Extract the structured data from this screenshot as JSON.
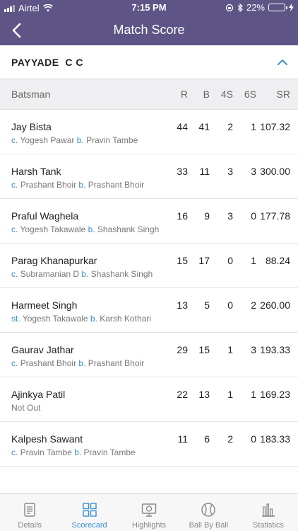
{
  "status": {
    "carrier": "Airtel",
    "time": "7:15 PM",
    "battery": "22%",
    "battery_level": 0.22
  },
  "nav": {
    "title": "Match Score"
  },
  "team": {
    "name": "PAYYADE  C C"
  },
  "header": {
    "batsman": "Batsman",
    "r": "R",
    "b": "B",
    "fours": "4S",
    "sixes": "6S",
    "sr": "SR"
  },
  "batsmen": [
    {
      "name": "Jay Bista",
      "dis1_k": "c.",
      "dis1": "Yogesh Pawar",
      "dis2_k": "b.",
      "dis2": "Pravin Tambe",
      "r": "44",
      "b": "41",
      "fours": "2",
      "sixes": "1",
      "sr": "107.32"
    },
    {
      "name": "Harsh Tank",
      "dis1_k": "c.",
      "dis1": "Prashant Bhoir",
      "dis2_k": "b.",
      "dis2": "Prashant Bhoir",
      "r": "33",
      "b": "11",
      "fours": "3",
      "sixes": "3",
      "sr": "300.00"
    },
    {
      "name": "Praful Waghela",
      "dis1_k": "c.",
      "dis1": "Yogesh Takawale",
      "dis2_k": "b.",
      "dis2": "Shashank Singh",
      "r": "16",
      "b": "9",
      "fours": "3",
      "sixes": "0",
      "sr": "177.78"
    },
    {
      "name": "Parag Khanapurkar",
      "dis1_k": "c.",
      "dis1": "Subramanian D",
      "dis2_k": "b.",
      "dis2": "Shashank Singh",
      "r": "15",
      "b": "17",
      "fours": "0",
      "sixes": "1",
      "sr": "88.24"
    },
    {
      "name": "Harmeet Singh",
      "dis1_k": "st.",
      "dis1": "Yogesh Takawale",
      "dis2_k": "b.",
      "dis2": "Karsh Kothari",
      "r": "13",
      "b": "5",
      "fours": "0",
      "sixes": "2",
      "sr": "260.00"
    },
    {
      "name": "Gaurav Jathar",
      "dis1_k": "c.",
      "dis1": "Prashant Bhoir",
      "dis2_k": "b.",
      "dis2": "Prashant Bhoir",
      "r": "29",
      "b": "15",
      "fours": "1",
      "sixes": "3",
      "sr": "193.33"
    },
    {
      "name": "Ajinkya Patil",
      "dis_plain": "Not Out",
      "r": "22",
      "b": "13",
      "fours": "1",
      "sixes": "1",
      "sr": "169.23"
    },
    {
      "name": "Kalpesh Sawant",
      "dis1_k": "c.",
      "dis1": "Pravin Tambe",
      "dis2_k": "b.",
      "dis2": "Pravin Tambe",
      "r": "11",
      "b": "6",
      "fours": "2",
      "sixes": "0",
      "sr": "183.33"
    }
  ],
  "tabs": [
    {
      "label": "Details",
      "icon": "document-icon"
    },
    {
      "label": "Scorecard",
      "icon": "grid-icon",
      "active": true
    },
    {
      "label": "Highlights",
      "icon": "tv-icon"
    },
    {
      "label": "Ball By Ball",
      "icon": "baseball-icon"
    },
    {
      "label": "Statistics",
      "icon": "bar-chart-icon"
    }
  ],
  "colors": {
    "header_bg": "#5e5586",
    "accent": "#3d8fcf",
    "battery": "#f0c419"
  }
}
